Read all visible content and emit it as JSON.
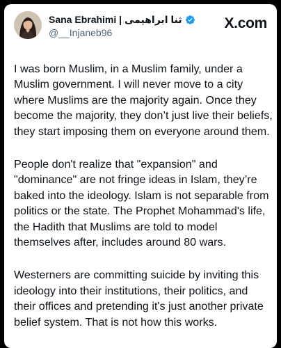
{
  "post": {
    "author": {
      "display_name": "Sana Ebrahimi | ثنا ابراهیمی",
      "handle": "@__Injaneb96",
      "verified_badge_icon": "verified-check-icon",
      "verified_color": "#1d9bf0"
    },
    "brand": "X.com",
    "paragraphs": [
      "I was born Muslim, in a Muslim family, under a Muslim government. I will never move to a city where Muslims are the majority again. Once they become the majority, they don’t just live their beliefs, they start imposing them on everyone around them.",
      "People don't realize that \"expansion\" and \"dominance\" are not fringe ideas in Islam, they’re baked into the ideology. Islam is not separable from politics or the state. The Prophet Mohammad's life, the Hadith that Muslims are told to model themselves after, includes around 80 wars.",
      "Westerners are committing suicide by inviting this ideology into their institutions, their politics, and their offices and pretending it's just another private belief system. That is not how this works."
    ]
  }
}
